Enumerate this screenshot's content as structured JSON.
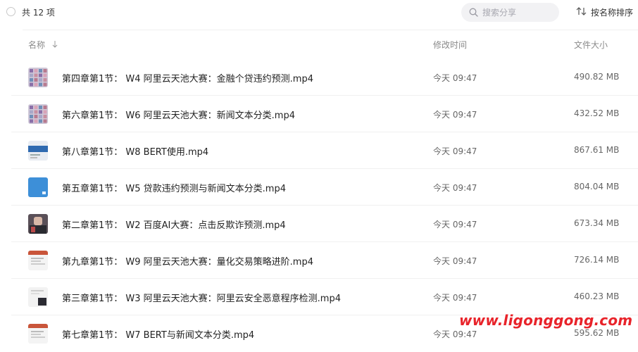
{
  "toolbar": {
    "count_label": "共 12 项",
    "search_placeholder": "搜索分享",
    "sort_label": "按名称排序"
  },
  "columns": {
    "name": "名称",
    "time": "修改时间",
    "size": "文件大小"
  },
  "files": [
    {
      "name": "第四章第1节： W4 阿里云天池大赛：金融个贷违约预测.mp4",
      "time": "今天 09:47",
      "size": "490.82 MB",
      "thumb": "grid"
    },
    {
      "name": "第六章第1节： W6 阿里云天池大赛：新闻文本分类.mp4",
      "time": "今天 09:47",
      "size": "432.52 MB",
      "thumb": "grid"
    },
    {
      "name": "第八章第1节： W8 BERT使用.mp4",
      "time": "今天 09:47",
      "size": "867.61 MB",
      "thumb": "slide-blue"
    },
    {
      "name": "第五章第1节： W5 贷款违约预测与新闻文本分类.mp4",
      "time": "今天 09:47",
      "size": "804.04 MB",
      "thumb": "blue"
    },
    {
      "name": "第二章第1节： W2 百度AI大赛：点击反欺诈预测.mp4",
      "time": "今天 09:47",
      "size": "673.34 MB",
      "thumb": "dark"
    },
    {
      "name": "第九章第1节： W9 阿里云天池大赛：量化交易策略进阶.mp4",
      "time": "今天 09:47",
      "size": "726.14 MB",
      "thumb": "doc-red"
    },
    {
      "name": "第三章第1节： W3 阿里云天池大赛：阿里云安全恶意程序检测.mp4",
      "time": "今天 09:47",
      "size": "460.23 MB",
      "thumb": "doc-dark"
    },
    {
      "name": "第七章第1节： W7 BERT与新闻文本分类.mp4",
      "time": "今天 09:47",
      "size": "595.62 MB",
      "thumb": "doc-red"
    }
  ],
  "watermark": "www.ligonggong.com"
}
